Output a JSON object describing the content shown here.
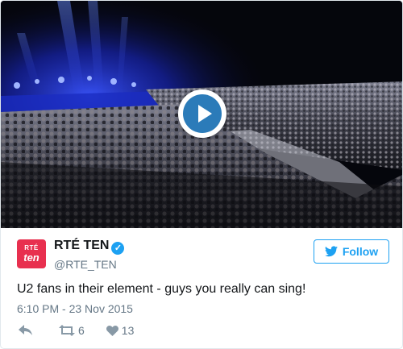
{
  "media": {
    "description_icon": "play-icon",
    "accent_color": "#2b7bb9"
  },
  "account": {
    "avatar_line1": "RTÉ",
    "avatar_line2": "ten",
    "avatar_color": "#e8304f",
    "display_name": "RTÉ TEN",
    "verified_icon": "verified-badge-icon",
    "handle": "@RTE_TEN"
  },
  "follow_button": {
    "label": "Follow",
    "icon": "twitter-bird-icon",
    "color": "#1da1f2"
  },
  "tweet": {
    "text": "U2 fans in their element - guys you really can sing!",
    "timestamp": "6:10 PM - 23 Nov 2015"
  },
  "actions": {
    "reply_icon": "reply-icon",
    "retweet_icon": "retweet-icon",
    "retweet_count": "6",
    "like_icon": "heart-icon",
    "like_count": "13"
  }
}
